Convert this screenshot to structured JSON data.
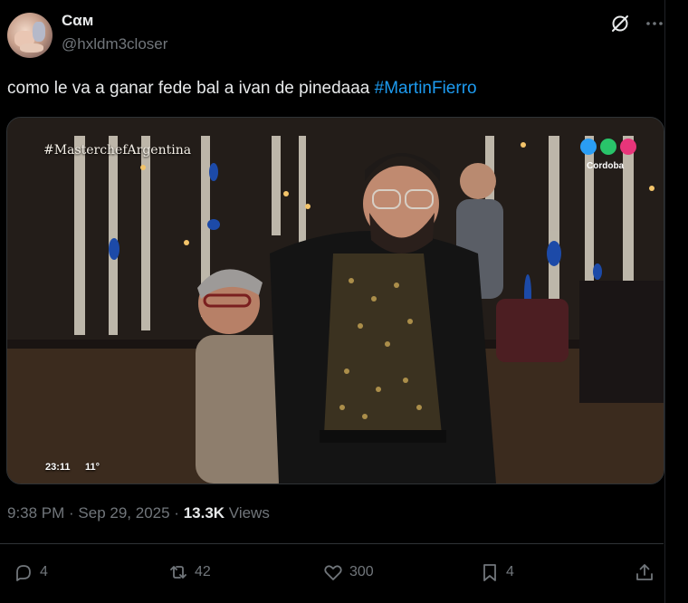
{
  "author": {
    "display_name": "Cαм",
    "handle": "@hxldm3closer"
  },
  "tweet": {
    "text": "como le va a ganar fede bal a ivan de pinedaaa ",
    "hashtag": "#MartinFierro"
  },
  "media": {
    "show_tag": "#MasterchefArgentina",
    "channel_label": "Cordoba",
    "clock": "23:11",
    "temperature": "11°"
  },
  "meta": {
    "time": "9:38 PM",
    "separator": " · ",
    "date": "Sep 29, 2025",
    "views_count": "13.3K",
    "views_label": " Views"
  },
  "actions": {
    "replies": "4",
    "reposts": "42",
    "likes": "300",
    "bookmarks": "4"
  },
  "icons": {
    "grok": "grok-icon",
    "more": "more-icon",
    "reply": "reply-icon",
    "repost": "repost-icon",
    "like": "heart-icon",
    "bookmark": "bookmark-icon",
    "share": "share-icon"
  },
  "colors": {
    "background": "#000000",
    "text": "#e7e9ea",
    "muted": "#71767b",
    "hashtag": "#1d9bf0",
    "border": "#2f3336"
  }
}
